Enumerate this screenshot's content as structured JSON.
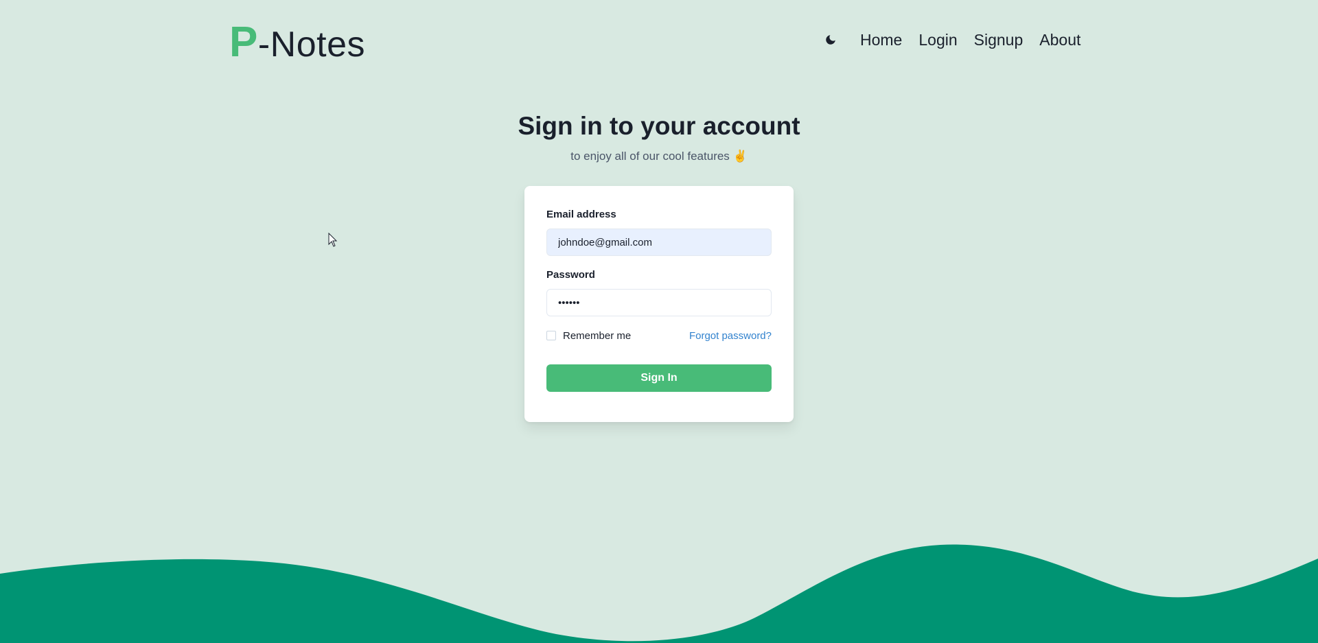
{
  "header": {
    "logo_mark": "P",
    "logo_text": "-Notes",
    "theme_toggle_icon": "moon-icon",
    "nav": [
      {
        "label": "Home"
      },
      {
        "label": "Login"
      },
      {
        "label": "Signup"
      },
      {
        "label": "About"
      }
    ]
  },
  "heading": {
    "title": "Sign in to your account",
    "subtitle": "to enjoy all of our cool features ✌️"
  },
  "form": {
    "email_label": "Email address",
    "email_value": "johndoe@gmail.com",
    "password_label": "Password",
    "password_value": "••••••",
    "remember_label": "Remember me",
    "forgot_label": "Forgot password?",
    "submit_label": "Sign In"
  },
  "colors": {
    "background": "#d8e9e1",
    "accent": "#48bb78",
    "link": "#3182ce",
    "wave": "#009473"
  }
}
